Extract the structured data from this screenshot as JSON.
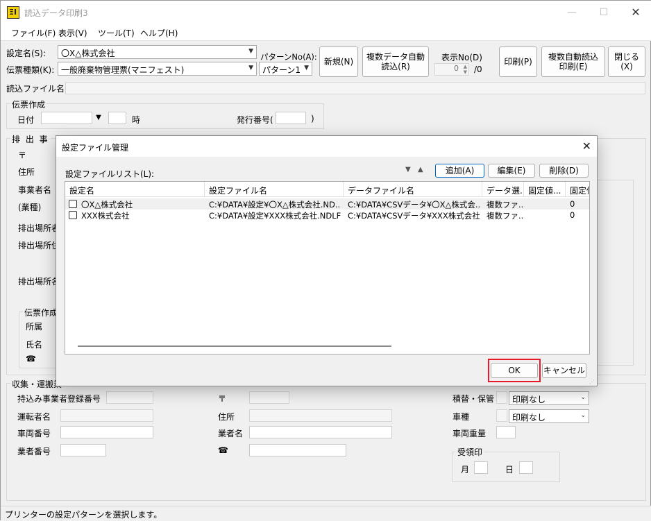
{
  "window": {
    "title": "読込データ印刷3",
    "controls": {
      "minimize": "—",
      "maximize": "☐",
      "close": "✕"
    }
  },
  "menu": [
    "ファイル(F)",
    "表示(V)",
    "ツール(T)",
    "ヘルプ(H)"
  ],
  "toolbar": {
    "setting_name_label": "設定名(S):",
    "setting_name_value": "〇X△株式会社",
    "slip_type_label": "伝票種類(K):",
    "slip_type_value": "一般廃棄物管理票(マニフェスト)",
    "pattern_no_label": "パターンNo(A):",
    "pattern_value": "パターン1",
    "new_button": "新規(N)",
    "auto_import_button": "複数データ自動\n読込(R)",
    "display_no_label": "表示No(D)",
    "display_no_value": "0",
    "display_no_total": "/0",
    "print_button": "印刷(P)",
    "auto_import_print_button": "複数自動読込\n印刷(E)",
    "close_button": "閉じる(X)"
  },
  "import_file_label": "読込ファイル名",
  "slip_creation": {
    "title": "伝票作成",
    "date_label": "日付",
    "hour_label": "時",
    "issue_no_label": "発行番号(",
    "issue_no_close": ")"
  },
  "emitter": {
    "title": "排 出 事",
    "postal_label": "〒",
    "address_label": "住所",
    "company_label": "事業者名",
    "industry_label": "(業種)",
    "site_name_label": "排出場所者",
    "site_address_label": "排出場所住",
    "site_label3": "排出場所名",
    "sub_title": "伝票作成",
    "dept_label": "所属",
    "name_label": "氏名",
    "phone_icon": "☎"
  },
  "collection": {
    "title": "収集・運搬業",
    "registration_label": "持込み事業者登録番号",
    "driver_label": "運転者名",
    "vehicle_no_label": "車両番号",
    "company_no_label": "業者番号",
    "postal_label": "〒",
    "address_label": "住所",
    "company_name_label": "業者名",
    "phone_icon": "☎",
    "transship_label": "積替・保管",
    "transship_value": "印刷なし",
    "vehicle_type_label": "車種",
    "vehicle_type_value": "印刷なし",
    "vehicle_weight_label": "車両重量",
    "receipt_title": "受領印",
    "month_label": "月",
    "day_label": "日"
  },
  "status_text": "プリンターの設定パターンを選択します。",
  "dialog": {
    "title": "設定ファイル管理",
    "list_label": "設定ファイルリスト(L):",
    "add_button": "追加(A)",
    "edit_button": "編集(E)",
    "delete_button": "削除(D)",
    "columns": [
      "設定名",
      "設定ファイル名",
      "データファイル名",
      "データ選...",
      "固定値...",
      "固定値"
    ],
    "rows": [
      {
        "name": "〇X△株式会社",
        "file": "C:¥DATA¥設定¥〇X△株式会社.ND...",
        "data": "C:¥DATA¥CSVデータ¥〇X△株式会...",
        "select": "複数ファ...",
        "fixed": "",
        "fixed2": "0"
      },
      {
        "name": "XXX株式会社",
        "file": "C:¥DATA¥設定¥XXX株式会社.NDLF",
        "data": "C:¥DATA¥CSVデータ¥XXX株式会社...",
        "select": "複数ファ...",
        "fixed": "",
        "fixed2": "0"
      }
    ],
    "ok_button": "OK",
    "cancel_button": "キャンセル"
  }
}
